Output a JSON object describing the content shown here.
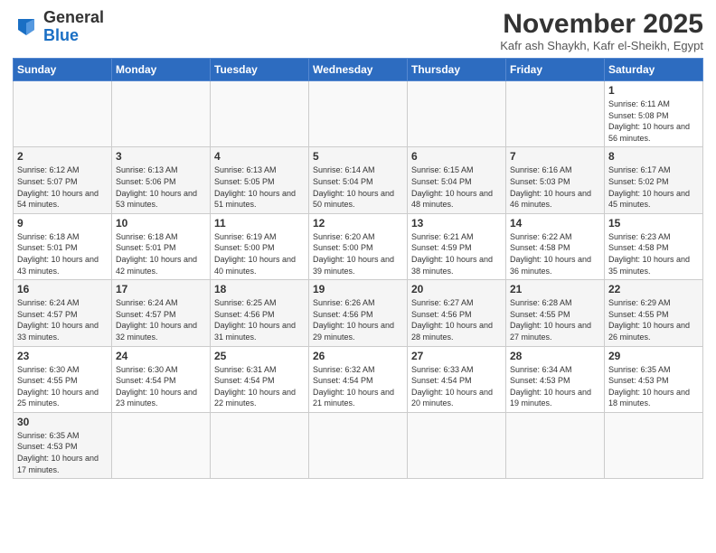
{
  "logo": {
    "text_general": "General",
    "text_blue": "Blue"
  },
  "header": {
    "month": "November 2025",
    "location": "Kafr ash Shaykh, Kafr el-Sheikh, Egypt"
  },
  "weekdays": [
    "Sunday",
    "Monday",
    "Tuesday",
    "Wednesday",
    "Thursday",
    "Friday",
    "Saturday"
  ],
  "weeks": [
    [
      {
        "day": "",
        "info": ""
      },
      {
        "day": "",
        "info": ""
      },
      {
        "day": "",
        "info": ""
      },
      {
        "day": "",
        "info": ""
      },
      {
        "day": "",
        "info": ""
      },
      {
        "day": "",
        "info": ""
      },
      {
        "day": "1",
        "info": "Sunrise: 6:11 AM\nSunset: 5:08 PM\nDaylight: 10 hours and 56 minutes."
      }
    ],
    [
      {
        "day": "2",
        "info": "Sunrise: 6:12 AM\nSunset: 5:07 PM\nDaylight: 10 hours and 54 minutes."
      },
      {
        "day": "3",
        "info": "Sunrise: 6:13 AM\nSunset: 5:06 PM\nDaylight: 10 hours and 53 minutes."
      },
      {
        "day": "4",
        "info": "Sunrise: 6:13 AM\nSunset: 5:05 PM\nDaylight: 10 hours and 51 minutes."
      },
      {
        "day": "5",
        "info": "Sunrise: 6:14 AM\nSunset: 5:04 PM\nDaylight: 10 hours and 50 minutes."
      },
      {
        "day": "6",
        "info": "Sunrise: 6:15 AM\nSunset: 5:04 PM\nDaylight: 10 hours and 48 minutes."
      },
      {
        "day": "7",
        "info": "Sunrise: 6:16 AM\nSunset: 5:03 PM\nDaylight: 10 hours and 46 minutes."
      },
      {
        "day": "8",
        "info": "Sunrise: 6:17 AM\nSunset: 5:02 PM\nDaylight: 10 hours and 45 minutes."
      }
    ],
    [
      {
        "day": "9",
        "info": "Sunrise: 6:18 AM\nSunset: 5:01 PM\nDaylight: 10 hours and 43 minutes."
      },
      {
        "day": "10",
        "info": "Sunrise: 6:18 AM\nSunset: 5:01 PM\nDaylight: 10 hours and 42 minutes."
      },
      {
        "day": "11",
        "info": "Sunrise: 6:19 AM\nSunset: 5:00 PM\nDaylight: 10 hours and 40 minutes."
      },
      {
        "day": "12",
        "info": "Sunrise: 6:20 AM\nSunset: 5:00 PM\nDaylight: 10 hours and 39 minutes."
      },
      {
        "day": "13",
        "info": "Sunrise: 6:21 AM\nSunset: 4:59 PM\nDaylight: 10 hours and 38 minutes."
      },
      {
        "day": "14",
        "info": "Sunrise: 6:22 AM\nSunset: 4:58 PM\nDaylight: 10 hours and 36 minutes."
      },
      {
        "day": "15",
        "info": "Sunrise: 6:23 AM\nSunset: 4:58 PM\nDaylight: 10 hours and 35 minutes."
      }
    ],
    [
      {
        "day": "16",
        "info": "Sunrise: 6:24 AM\nSunset: 4:57 PM\nDaylight: 10 hours and 33 minutes."
      },
      {
        "day": "17",
        "info": "Sunrise: 6:24 AM\nSunset: 4:57 PM\nDaylight: 10 hours and 32 minutes."
      },
      {
        "day": "18",
        "info": "Sunrise: 6:25 AM\nSunset: 4:56 PM\nDaylight: 10 hours and 31 minutes."
      },
      {
        "day": "19",
        "info": "Sunrise: 6:26 AM\nSunset: 4:56 PM\nDaylight: 10 hours and 29 minutes."
      },
      {
        "day": "20",
        "info": "Sunrise: 6:27 AM\nSunset: 4:56 PM\nDaylight: 10 hours and 28 minutes."
      },
      {
        "day": "21",
        "info": "Sunrise: 6:28 AM\nSunset: 4:55 PM\nDaylight: 10 hours and 27 minutes."
      },
      {
        "day": "22",
        "info": "Sunrise: 6:29 AM\nSunset: 4:55 PM\nDaylight: 10 hours and 26 minutes."
      }
    ],
    [
      {
        "day": "23",
        "info": "Sunrise: 6:30 AM\nSunset: 4:55 PM\nDaylight: 10 hours and 25 minutes."
      },
      {
        "day": "24",
        "info": "Sunrise: 6:30 AM\nSunset: 4:54 PM\nDaylight: 10 hours and 23 minutes."
      },
      {
        "day": "25",
        "info": "Sunrise: 6:31 AM\nSunset: 4:54 PM\nDaylight: 10 hours and 22 minutes."
      },
      {
        "day": "26",
        "info": "Sunrise: 6:32 AM\nSunset: 4:54 PM\nDaylight: 10 hours and 21 minutes."
      },
      {
        "day": "27",
        "info": "Sunrise: 6:33 AM\nSunset: 4:54 PM\nDaylight: 10 hours and 20 minutes."
      },
      {
        "day": "28",
        "info": "Sunrise: 6:34 AM\nSunset: 4:53 PM\nDaylight: 10 hours and 19 minutes."
      },
      {
        "day": "29",
        "info": "Sunrise: 6:35 AM\nSunset: 4:53 PM\nDaylight: 10 hours and 18 minutes."
      }
    ],
    [
      {
        "day": "30",
        "info": "Sunrise: 6:35 AM\nSunset: 4:53 PM\nDaylight: 10 hours and 17 minutes."
      },
      {
        "day": "",
        "info": ""
      },
      {
        "day": "",
        "info": ""
      },
      {
        "day": "",
        "info": ""
      },
      {
        "day": "",
        "info": ""
      },
      {
        "day": "",
        "info": ""
      },
      {
        "day": "",
        "info": ""
      }
    ]
  ]
}
